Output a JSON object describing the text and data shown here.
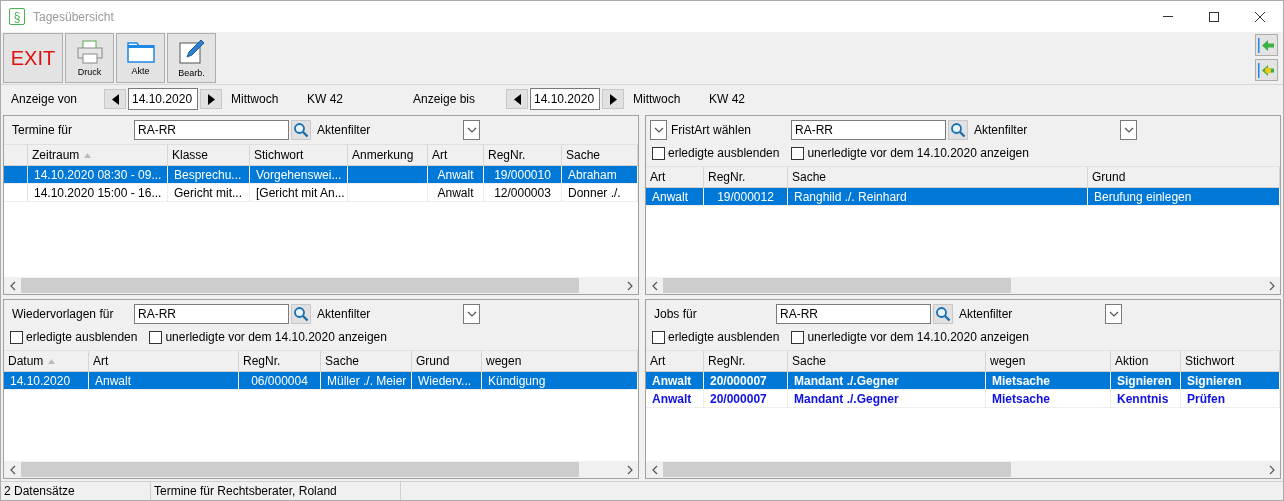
{
  "window": {
    "title": "Tagesübersicht",
    "icon_glyph": "§"
  },
  "toolbar": {
    "buttons": [
      {
        "kind": "exit",
        "label": "EXIT"
      },
      {
        "kind": "print",
        "label": "Druck"
      },
      {
        "kind": "folder",
        "label": "Akte"
      },
      {
        "kind": "edit",
        "label": "Bearb."
      }
    ]
  },
  "date_bar": [
    {
      "label": "Anzeige von",
      "date": "14.10.2020",
      "weekday": "Mittwoch",
      "week": "KW 42"
    },
    {
      "label": "Anzeige bis",
      "date": "14.10.2020",
      "weekday": "Mittwoch",
      "week": "KW 42"
    }
  ],
  "panels": [
    {
      "kind": "termine",
      "label": "Termine für",
      "value": "RA-RR",
      "filter_label": "Aktenfilter",
      "columns": [
        {
          "label": "Zeitraum",
          "sorted": true
        },
        {
          "label": "Klasse",
          "sorted": false
        },
        {
          "label": "Stichwort",
          "sorted": false
        },
        {
          "label": "Anmerkung",
          "sorted": false
        },
        {
          "label": "Art",
          "sorted": false
        },
        {
          "label": "RegNr.",
          "sorted": false
        },
        {
          "label": "Sache",
          "sorted": false
        }
      ],
      "rows": [
        {
          "selected": true,
          "cells": [
            "14.10.2020 08:30 - 09...",
            "Besprechu...",
            "Vorgehenswei...",
            "",
            "Anwalt",
            "19/000010",
            "Abraham"
          ]
        },
        {
          "selected": false,
          "cells": [
            "14.10.2020 15:00 - 16...",
            "Gericht mit...",
            "[Gericht mit An...",
            "",
            "Anwalt",
            "12/000003",
            "Donner ./."
          ]
        }
      ]
    },
    {
      "kind": "fristen",
      "label": "FristArt wählen",
      "value": "RA-RR",
      "filter_label": "Aktenfilter",
      "checkboxes": [
        {
          "label": "erledigte ausblenden",
          "checked": false
        },
        {
          "label": "unerledigte vor dem 14.10.2020 anzeigen",
          "checked": false
        }
      ],
      "columns": [
        {
          "label": "Art",
          "sorted": false
        },
        {
          "label": "RegNr.",
          "sorted": false
        },
        {
          "label": "Sache",
          "sorted": false
        },
        {
          "label": "Grund",
          "sorted": false
        }
      ],
      "rows": [
        {
          "selected": true,
          "cells": [
            "Anwalt",
            "19/000012",
            "Ranghild ./. Reinhard",
            "Berufung einlegen"
          ]
        }
      ]
    },
    {
      "kind": "wiedervorlagen",
      "label": "Wiedervorlagen für",
      "value": "RA-RR",
      "filter_label": "Aktenfilter",
      "checkboxes": [
        {
          "label": "erledigte ausblenden",
          "checked": false
        },
        {
          "label": "unerledigte vor dem 14.10.2020 anzeigen",
          "checked": false
        }
      ],
      "columns": [
        {
          "label": "Datum",
          "sorted": true
        },
        {
          "label": "Art",
          "sorted": false
        },
        {
          "label": "RegNr.",
          "sorted": false
        },
        {
          "label": "Sache",
          "sorted": false
        },
        {
          "label": "Grund",
          "sorted": false
        },
        {
          "label": "wegen",
          "sorted": false
        }
      ],
      "rows": [
        {
          "selected": true,
          "cells": [
            "14.10.2020",
            "Anwalt",
            "06/000004",
            "Müller ./. Meier",
            "Wiederv...",
            "Kündigung"
          ]
        }
      ]
    },
    {
      "kind": "jobs",
      "label": "Jobs für",
      "value": "RA-RR",
      "filter_label": "Aktenfilter",
      "checkboxes": [
        {
          "label": "erledigte ausblenden",
          "checked": false
        },
        {
          "label": "unerledigte vor dem 14.10.2020 anzeigen",
          "checked": false
        }
      ],
      "columns": [
        {
          "label": "Art",
          "sorted": false
        },
        {
          "label": "RegNr.",
          "sorted": false
        },
        {
          "label": "Sache",
          "sorted": false
        },
        {
          "label": "wegen",
          "sorted": false
        },
        {
          "label": "Aktion",
          "sorted": false
        },
        {
          "label": "Stichwort",
          "sorted": false
        }
      ],
      "rows": [
        {
          "selected": true,
          "cells": [
            "Anwalt",
            "20/000007",
            "Mandant ./.Gegner",
            "Mietsache",
            "Signieren",
            "Signieren"
          ]
        },
        {
          "selected": false,
          "cells": [
            "Anwalt",
            "20/000007",
            "Mandant ./.Gegner",
            "Mietsache",
            "Kenntnis",
            "Prüfen"
          ]
        }
      ]
    }
  ],
  "status_bar": [
    "2 Datensätze",
    "Termine für Rechtsberater, Roland"
  ]
}
